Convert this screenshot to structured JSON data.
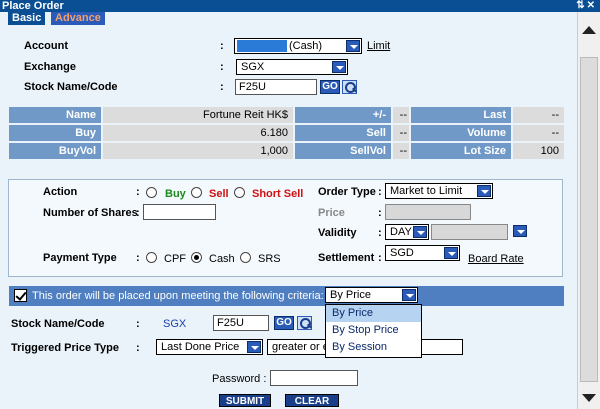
{
  "window": {
    "title": "Place Order",
    "controls": "⇅✕"
  },
  "tabs": [
    {
      "label": "Basic"
    },
    {
      "label": "Advance"
    }
  ],
  "account": {
    "label": "Account",
    "colon": ":",
    "value": "(Cash)",
    "link": "Limit"
  },
  "exchange": {
    "label": "Exchange",
    "colon": ":",
    "value": "SGX"
  },
  "stock": {
    "label": "Stock Name/Code",
    "colon": ":",
    "value": "F25U",
    "go": "GO"
  },
  "quote": {
    "rows": [
      {
        "h1": "Name",
        "v1": "Fortune Reit HK$",
        "h2": "+/-",
        "v2": "--",
        "h3": "Last",
        "v3": "--"
      },
      {
        "h1": "Buy",
        "v1": "6.180",
        "h2": "Sell",
        "v2": "--",
        "h3": "Volume",
        "v3": "--"
      },
      {
        "h1": "BuyVol",
        "v1": "1,000",
        "h2": "SellVol",
        "v2": "--",
        "h3": "Lot Size",
        "v3": "100"
      }
    ]
  },
  "order": {
    "action_label": "Action",
    "colon": ":",
    "action_buy": "Buy",
    "action_sell": "Sell",
    "action_short": "Short Sell",
    "colors": {
      "buy": "#1a8a1a",
      "sell": "#d01010"
    },
    "order_type_label": "Order Type",
    "order_type_value": "Market to Limit",
    "shares_label": "Number of Shares",
    "price_label": "Price",
    "validity_label": "Validity",
    "validity_value": "DAY",
    "payment_label": "Payment Type",
    "pay_cpf": "CPF",
    "pay_cash": "Cash",
    "pay_srs": "SRS",
    "settlement_label": "Settlement",
    "settlement_value": "SGD",
    "board_rate": "Board Rate"
  },
  "criteria": {
    "text": "This order will be placed upon meeting the following criteria:",
    "select_value": "By Price",
    "options": [
      "By Price",
      "By Stop Price",
      "By Session"
    ],
    "stock_label": "Stock Name/Code",
    "exchange": "SGX",
    "stock_value": "F25U",
    "go": "GO",
    "trig_label": "Triggered Price Type",
    "trig_value": "Last Done Price",
    "condition_value": "greater or e"
  },
  "footer": {
    "password_label": "Password :",
    "submit": "SUBMIT",
    "clear": "CLEAR"
  }
}
